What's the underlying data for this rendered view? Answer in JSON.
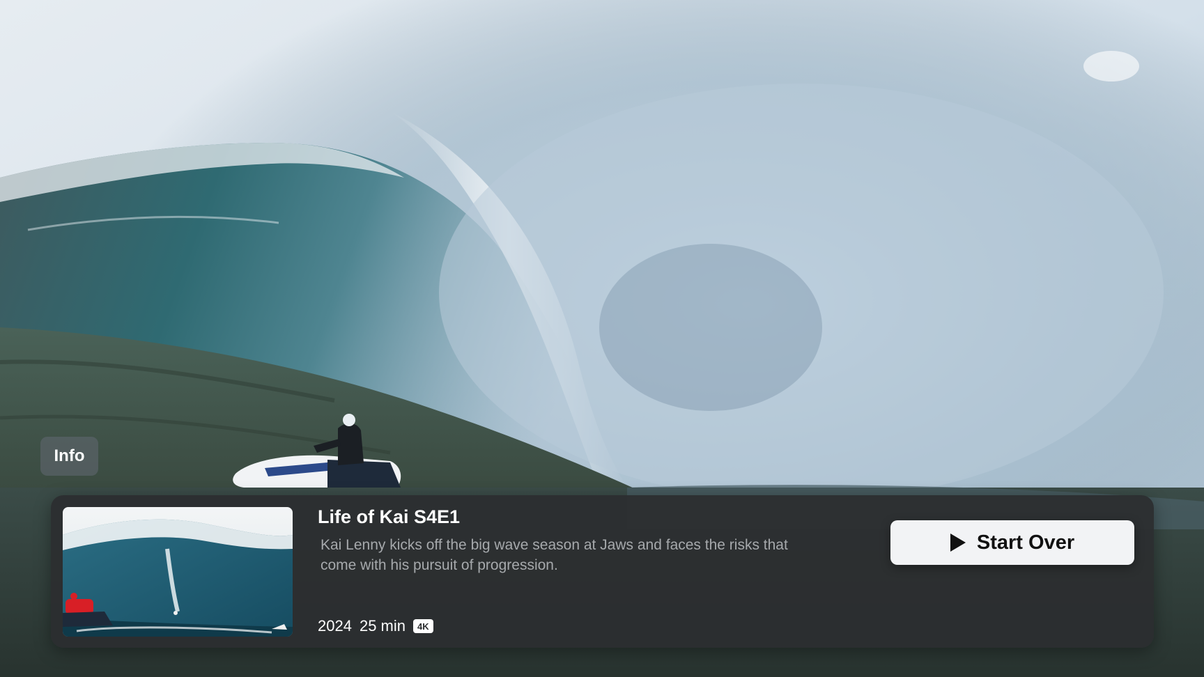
{
  "info_tab": {
    "label": "Info"
  },
  "episode": {
    "title": "Life of Kai S4E1",
    "description": "Kai Lenny kicks off the big wave season at Jaws and faces the risks that come with his pursuit of progression.",
    "year": "2024",
    "duration": "25 min",
    "quality_badge": "4K"
  },
  "actions": {
    "start_over_label": "Start Over",
    "start_over_icon": "play-icon"
  },
  "colors": {
    "panel_background": "#2c2e30",
    "button_background": "#f2f3f5",
    "description_text": "#a6a9ac"
  }
}
